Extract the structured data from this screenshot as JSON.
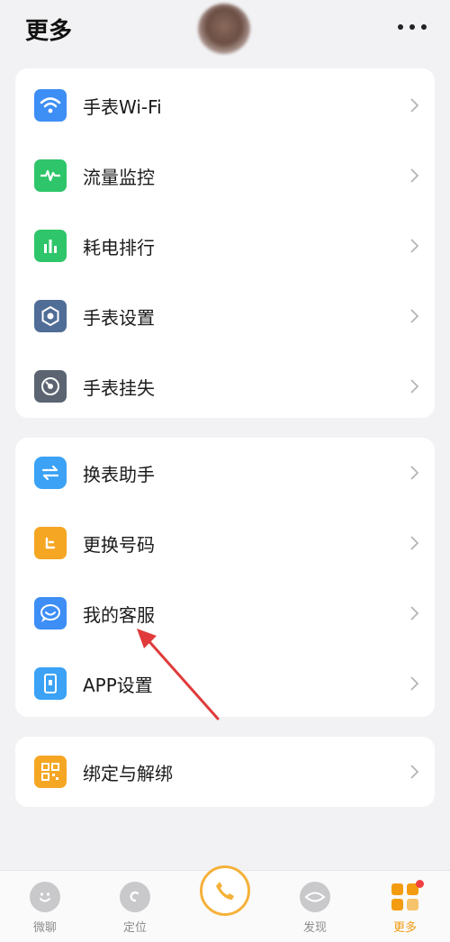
{
  "header": {
    "title": "更多"
  },
  "card1": {
    "items": [
      {
        "label": "手表Wi-Fi",
        "icon": "wifi-icon",
        "color": "#3d8ef5"
      },
      {
        "label": "流量监控",
        "icon": "pulse-icon",
        "color": "#2fc56a"
      },
      {
        "label": "耗电排行",
        "icon": "bar-chart-icon",
        "color": "#2fc56a"
      },
      {
        "label": "手表设置",
        "icon": "settings-icon",
        "color": "#4f6d96"
      },
      {
        "label": "手表挂失",
        "icon": "lost-watch-icon",
        "color": "#5b6470"
      }
    ]
  },
  "card2": {
    "items": [
      {
        "label": "换表助手",
        "icon": "swap-watch-icon",
        "color": "#3ba2f5"
      },
      {
        "label": "更换号码",
        "icon": "sim-icon",
        "color": "#f5a623"
      },
      {
        "label": "我的客服",
        "icon": "chat-icon",
        "color": "#3d8ef5"
      },
      {
        "label": "APP设置",
        "icon": "phone-settings-icon",
        "color": "#3ba2f5"
      }
    ]
  },
  "card3": {
    "items": [
      {
        "label": "绑定与解绑",
        "icon": "qr-code-icon",
        "color": "#f5a623"
      }
    ]
  },
  "tabbar": {
    "tabs": [
      {
        "label": "微聊",
        "icon": "smile-icon"
      },
      {
        "label": "定位",
        "icon": "location-icon"
      },
      {
        "label": "",
        "icon": "phone-call-icon"
      },
      {
        "label": "发现",
        "icon": "eye-icon"
      },
      {
        "label": "更多",
        "icon": "more-grid-icon",
        "active": true
      }
    ],
    "active_color": "#f39c12",
    "inactive_color": "#8d8d8f"
  }
}
